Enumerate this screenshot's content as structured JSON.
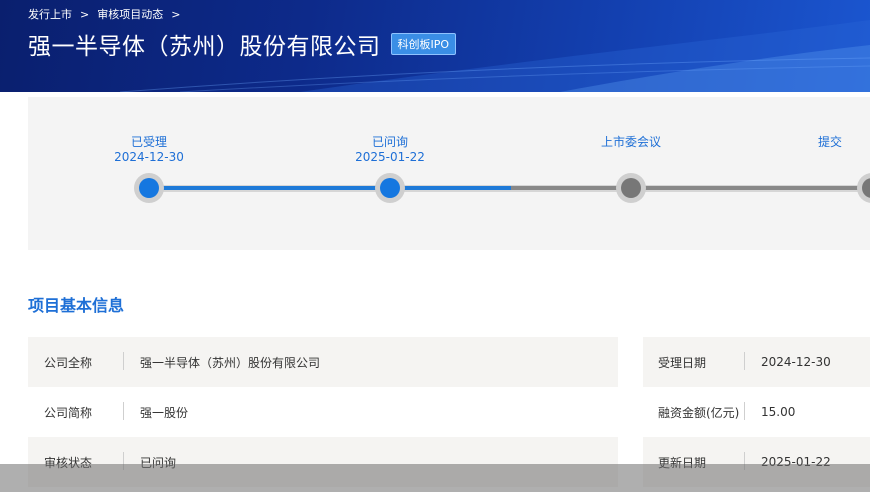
{
  "breadcrumb": {
    "items": [
      "发行上市",
      "审核项目动态"
    ],
    "separator": ">"
  },
  "header": {
    "title": "强一半导体（苏州）股份有限公司",
    "board_badge": "科创板IPO"
  },
  "progress": {
    "stages": [
      {
        "label": "已受理",
        "date": "2024-12-30",
        "status": "done"
      },
      {
        "label": "已问询",
        "date": "2025-01-22",
        "status": "done"
      },
      {
        "label": "上市委会议",
        "date": "",
        "status": "todo"
      },
      {
        "label": "提交",
        "date": "",
        "status": "todo"
      }
    ]
  },
  "section": {
    "title": "项目基本信息"
  },
  "info_left": [
    {
      "key": "公司全称",
      "value": "强一半导体（苏州）股份有限公司"
    },
    {
      "key": "公司简称",
      "value": "强一股份"
    },
    {
      "key": "审核状态",
      "value": "已问询"
    }
  ],
  "info_right": [
    {
      "key": "受理日期",
      "value": "2024-12-30"
    },
    {
      "key": "融资金额(亿元)",
      "value": "15.00"
    },
    {
      "key": "更新日期",
      "value": "2025-01-22"
    }
  ],
  "colors": {
    "accent": "#1e6fd6",
    "banner_dark": "#0a1f6e",
    "progress_done": "#1577e0",
    "progress_todo": "#777777"
  }
}
